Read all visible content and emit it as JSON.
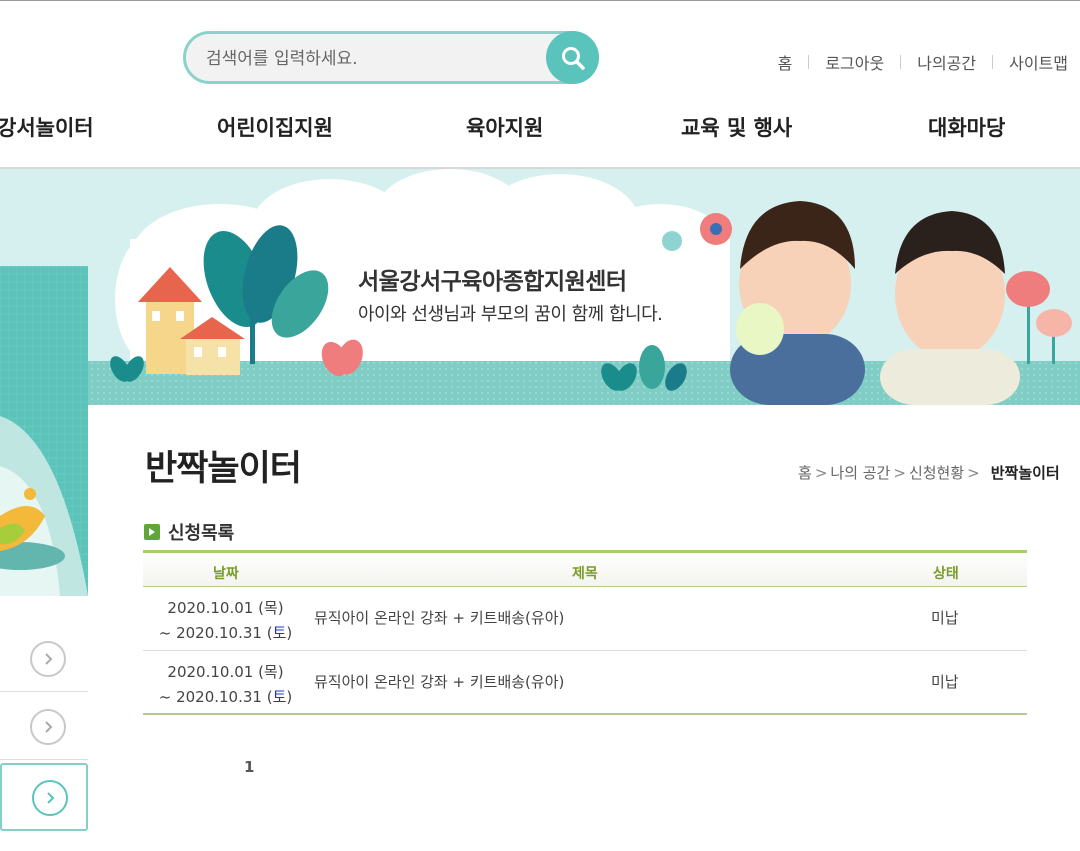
{
  "search": {
    "placeholder": "검색어를 입력하세요."
  },
  "util_links": [
    "홈",
    "로그아웃",
    "나의공간",
    "사이트맵"
  ],
  "gnb": [
    "강서놀이터",
    "어린이집지원",
    "육아지원",
    "교육 및 행사",
    "대화마당"
  ],
  "banner": {
    "title": "서울강서구육아종합지원센터",
    "subtitle": "아이와 선생님과 부모의 꿈이 함께 합니다."
  },
  "page": {
    "title": "반짝놀이터",
    "breadcrumb": [
      "홈",
      "나의 공간",
      "신청현황"
    ],
    "breadcrumb_current": "반짝놀이터"
  },
  "section": {
    "title": "신청목록"
  },
  "table": {
    "headers": [
      "날짜",
      "제목",
      "상태"
    ],
    "rows": [
      {
        "date_start": "2020.10.01 (목)",
        "date_end_prefix": "~ 2020.10.31 (",
        "date_end_day": "토",
        "date_end_suffix": ")",
        "subject": "뮤직아이 온라인 강좌 + 키트배송(유아)",
        "status": "미납"
      },
      {
        "date_start": "2020.10.01 (목)",
        "date_end_prefix": "~ 2020.10.31 (",
        "date_end_day": "토",
        "date_end_suffix": ")",
        "subject": "뮤직아이 온라인 강좌 + 키트배송(유아)",
        "status": "미납"
      }
    ]
  },
  "pagination": {
    "current": "1"
  },
  "icons": {
    "search": "search-icon",
    "arrow": "chevron-right-icon",
    "section": "play-bullet-icon"
  },
  "colors": {
    "accent": "#5ac4bc",
    "table_rule": "#a8cd6c",
    "header_text": "#7a9c28"
  }
}
